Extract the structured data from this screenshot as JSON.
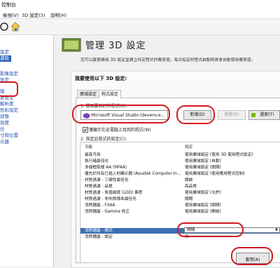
{
  "window": {
    "title": "控制台"
  },
  "menu": {
    "items": [
      "檢視(V)",
      "3D 設定(3)",
      "說明(H)"
    ]
  },
  "tree": {
    "items": [
      "設定",
      "選取",
      "影像設定",
      "設定",
      "版",
      "更設定",
      "解析度",
      "色彩設定",
      "狀態",
      "效度",
      "位",
      "寸和位置",
      "示器"
    ]
  },
  "header": {
    "title": "管理 3D 設定"
  },
  "description": "您可以變更廣域 3D 設定並建立特定程式的覆寫值。每次指定的程式啟動時將會自動使用覆寫值。",
  "panel": {
    "title": "我要使用以下 3D 設定:",
    "tabs": [
      "廣域設定",
      "程式設定"
    ],
    "step1_label": "1. 選取要自訂的程式(O):",
    "program": "Microsoft Visual Studio (devenv.e...",
    "add_button": "新增(D)",
    "remove_button": "移除(R)",
    "restore_button": "還原(T)",
    "checkbox_label": "僅顯示在此電腦上找到的程式(W)",
    "step2_label": "2. 指定此程式的設定(C):"
  },
  "settings_table": {
    "headers": [
      "功能",
      "設定"
    ],
    "rows": [
      [
        "最高可用",
        "使用廣域設定 (使用 3D 使用程式設定)"
      ],
      [
        "執行緒最佳化",
        "使用廣域設定 (自動)"
      ],
      [
        "多個框取樣 AA (MFAA)",
        "使用廣域設定 (關閉)"
      ],
      [
        "優先於所有已插入的顯示器 (Asustek Computer In...",
        "使用廣域設定 (使用應用程式控制)"
      ],
      [
        "材質過濾 - 三線性最佳化",
        "關啟"
      ],
      [
        "材質過濾 - 品質",
        "高品質"
      ],
      [
        "材質過濾 - 負值細度 (LOD) 偏差",
        "使用廣域設定 (允許)"
      ],
      [
        "材質過濾 - 非向質樣本最佳化",
        "關閉"
      ],
      [
        "消除鋸齒 - FXAA",
        "使用廣域設定 (關閉)"
      ],
      [
        "消除鋸齒 - Gamma 修正",
        "使用廣域設定 (開啟)"
      ],
      [
        "消除鋸齒 - 模式",
        "關閉"
      ],
      [
        "消除鋸齒 - 設定",
        "無"
      ]
    ],
    "selected_index": 10
  },
  "apply_button": "套用(A)",
  "colors": {
    "red_annotation": "#d21820",
    "selection": "#3d6fb5",
    "link": "#1a4fb0"
  }
}
